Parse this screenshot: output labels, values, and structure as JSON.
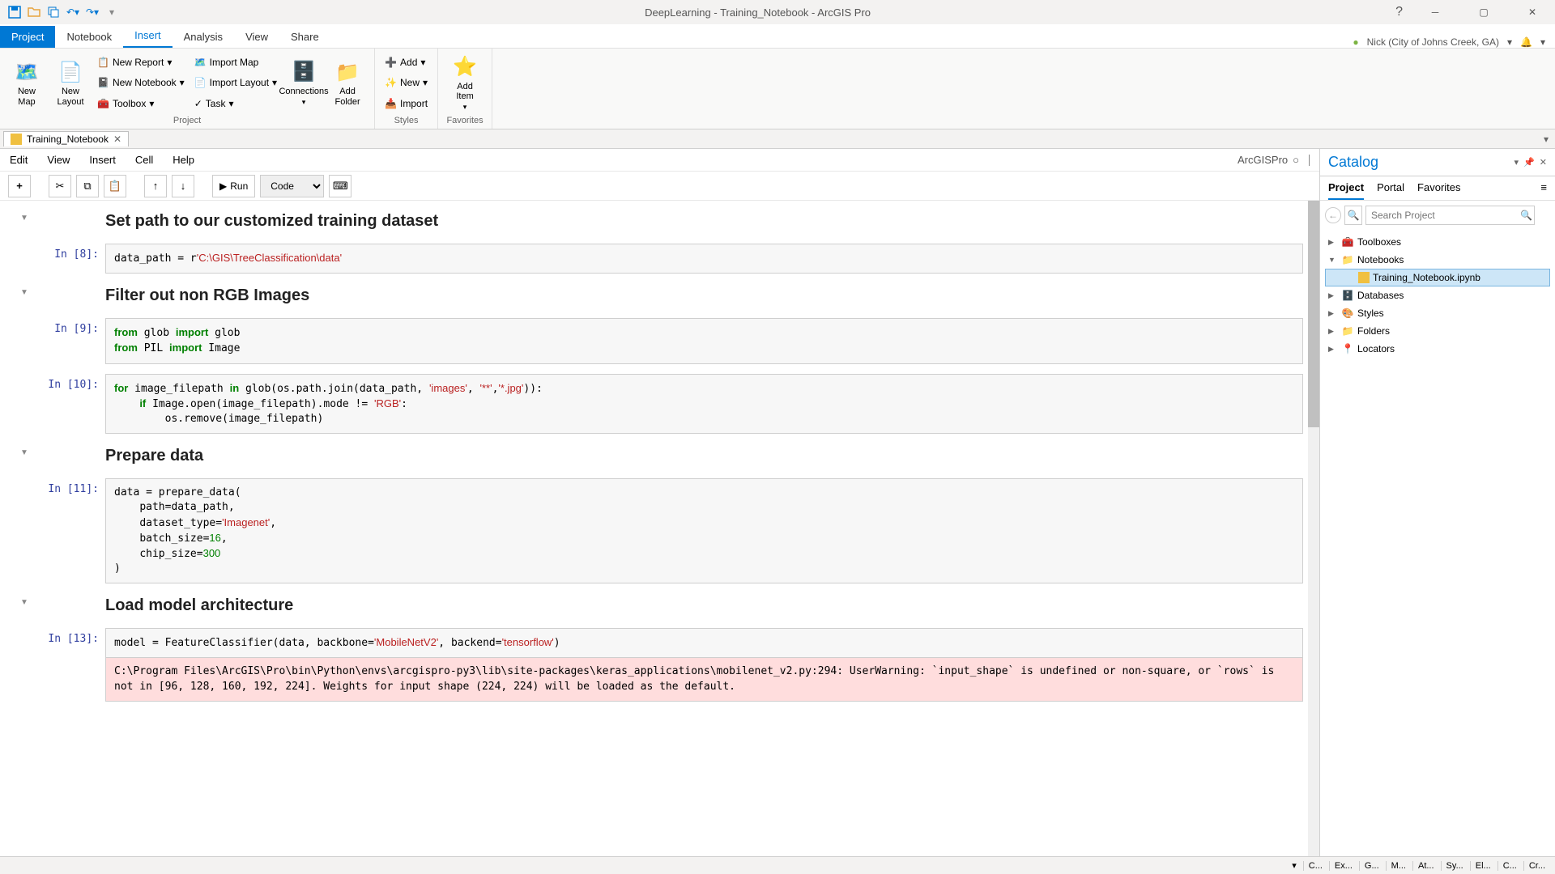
{
  "titlebar": {
    "title": "DeepLearning - Training_Notebook - ArcGIS Pro"
  },
  "tabs": {
    "project": "Project",
    "notebook": "Notebook",
    "insert": "Insert",
    "analysis": "Analysis",
    "view": "View",
    "share": "Share"
  },
  "user": "Nick (City of Johns Creek, GA)",
  "ribbon": {
    "new_map": "New\nMap",
    "new_layout": "New\nLayout",
    "new_report": "New Report",
    "new_notebook": "New Notebook",
    "toolbox": "Toolbox",
    "import_map": "Import Map",
    "import_layout": "Import Layout",
    "task": "Task",
    "connections": "Connections",
    "add_folder": "Add\nFolder",
    "add": "Add",
    "new": "New",
    "import": "Import",
    "add_item": "Add\nItem",
    "group_project": "Project",
    "group_styles": "Styles",
    "group_favorites": "Favorites"
  },
  "doctab": {
    "name": "Training_Notebook"
  },
  "notebook": {
    "menu": {
      "edit": "Edit",
      "view": "View",
      "insert": "Insert",
      "cell": "Cell",
      "help": "Help"
    },
    "kernel": "ArcGISPro",
    "toolbar": {
      "run": "Run",
      "celltype": "Code"
    },
    "cells": {
      "h1": "Set path to our customized training dataset",
      "p1": "In [8]:",
      "h2": "Filter out non RGB Images",
      "p2": "In [9]:",
      "p3": "In [10]:",
      "h3": "Prepare data",
      "p4": "In [11]:",
      "h4": "Load model architecture",
      "p5": "In [13]:",
      "warn": "C:\\Program Files\\ArcGIS\\Pro\\bin\\Python\\envs\\arcgispro-py3\\lib\\site-packages\\keras_applications\\mobilenet_v2.py:294: UserWarning: `input_shape` is undefined or non-square, or `rows` is not in [96, 128, 160, 192, 224]. Weights for input shape (224, 224) will be loaded as the default."
    }
  },
  "catalog": {
    "title": "Catalog",
    "tabs": {
      "project": "Project",
      "portal": "Portal",
      "favorites": "Favorites"
    },
    "search_placeholder": "Search Project",
    "items": {
      "toolboxes": "Toolboxes",
      "notebooks": "Notebooks",
      "nb1": "Training_Notebook.ipynb",
      "databases": "Databases",
      "styles": "Styles",
      "folders": "Folders",
      "locators": "Locators"
    }
  },
  "status": {
    "tabs": [
      "C...",
      "Ex...",
      "G...",
      "M...",
      "At...",
      "Sy...",
      "El...",
      "C...",
      "Cr..."
    ]
  }
}
